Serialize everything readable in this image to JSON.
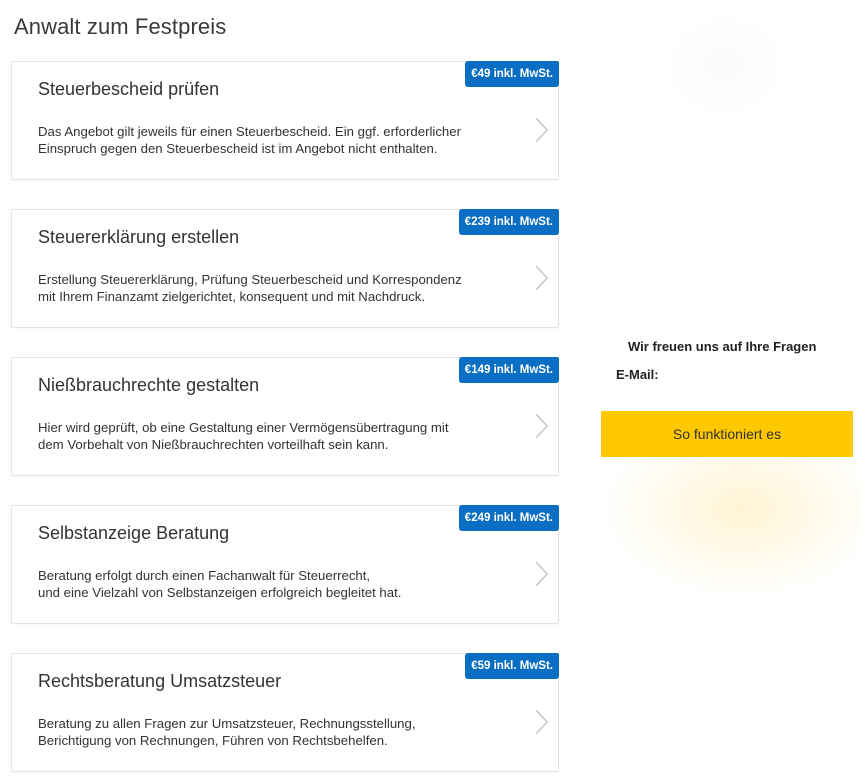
{
  "page": {
    "title": "Anwalt zum Festpreis"
  },
  "offers": [
    {
      "title": "Steuerbescheid prüfen",
      "price": "€49 inkl. MwSt.",
      "description_lines": [
        "Das Angebot gilt jeweils für einen Steuerbescheid. Ein ggf. erforderlicher",
        "Einspruch gegen den Steuerbescheid ist im Angebot nicht enthalten."
      ],
      "chevron_icon": "chevron-right-icon"
    },
    {
      "title": "Steuererklärung erstellen",
      "price": "€239 inkl. MwSt.",
      "description_lines": [
        "Erstellung Steuererklärung, Prüfung Steuerbescheid und Korrespondenz",
        "mit Ihrem Finanzamt zielgerichtet, konsequent und mit Nachdruck."
      ],
      "chevron_icon": "chevron-right-icon"
    },
    {
      "title": "Nießbrauchrechte gestalten",
      "price": "€149 inkl. MwSt.",
      "description_lines": [
        "Hier wird geprüft, ob eine Gestaltung einer Vermögensübertragung mit",
        "dem Vorbehalt von Nießbrauchrechten vorteilhaft sein kann."
      ],
      "chevron_icon": "chevron-right-icon"
    },
    {
      "title": "Selbstanzeige Beratung",
      "price": "€249 inkl. MwSt.",
      "description_lines": [
        "Beratung erfolgt durch einen Fachanwalt für Steuerrecht,",
        "und eine Vielzahl von Selbstanzeigen erfolgreich begleitet hat."
      ],
      "chevron_icon": "chevron-right-icon"
    },
    {
      "title": "Rechtsberatung Umsatzsteuer",
      "price": "€59 inkl. MwSt.",
      "description_lines": [
        "Beratung zu allen Fragen zur Umsatzsteuer, Rechnungsstellung,",
        "Berichtigung von Rechnungen, Führen von Rechtsbehelfen."
      ],
      "chevron_icon": "chevron-right-icon"
    }
  ],
  "sidebar": {
    "heading": "Wir freuen uns auf Ihre Fragen",
    "email_label": "E-Mail:",
    "email_value": "",
    "cta_label": "So funktioniert es"
  },
  "colors": {
    "badge_blue": "#0a6fc2",
    "cta_yellow": "#ffc800",
    "card_border": "#e3e3e3",
    "text_dark": "#333333"
  }
}
